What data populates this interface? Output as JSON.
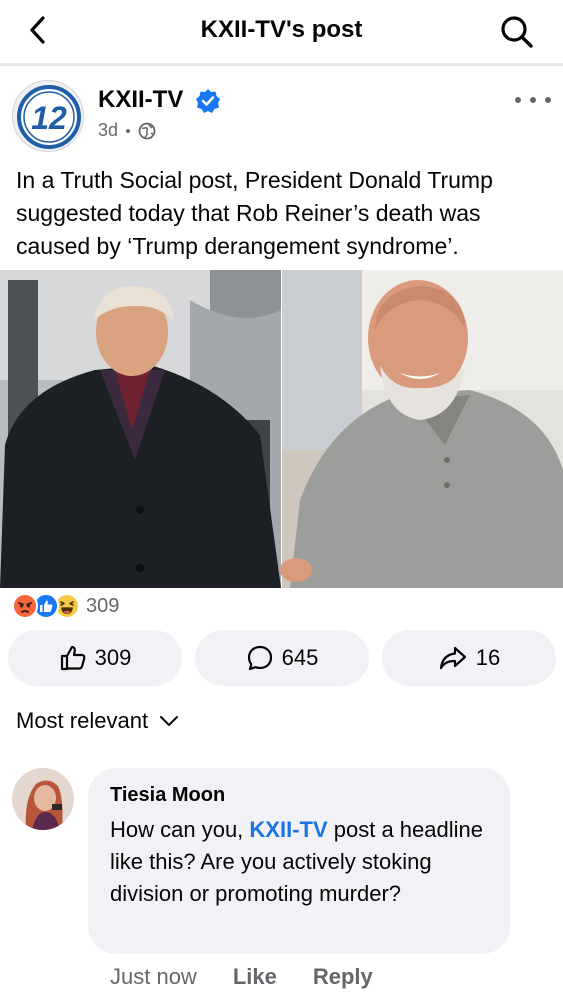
{
  "header": {
    "title": "KXII-TV's post",
    "back_icon": "chevron-left-icon",
    "search_icon": "search-icon"
  },
  "post": {
    "author": "KXII-TV",
    "logo_text": "12",
    "verified": true,
    "time": "3d",
    "audience_icon": "globe-icon",
    "text": "In a Truth Social post, President Donald Trump suggested today that Rob Reiner’s death was caused by ‘Trump derangement syndrome’.",
    "reactions": {
      "icons": [
        "angry-icon",
        "like-icon",
        "haha-icon"
      ],
      "count": "309"
    },
    "actions": {
      "like_count": "309",
      "comment_count": "645",
      "share_count": "16"
    }
  },
  "comments_section": {
    "sort_label": "Most relevant"
  },
  "comments": [
    {
      "author": "Tiesia Moon",
      "text_before": "How can you, ",
      "mention": "KXII-TV",
      "text_after": " post a headline like this? Are you actively stoking division or promoting murder?",
      "time": "Just now",
      "like_label": "Like",
      "reply_label": "Reply"
    }
  ],
  "colors": {
    "link_blue": "#1b74e4",
    "verified_blue": "#1877f2",
    "pill_bg": "#f0f2f5",
    "meta_gray": "#65676b"
  }
}
